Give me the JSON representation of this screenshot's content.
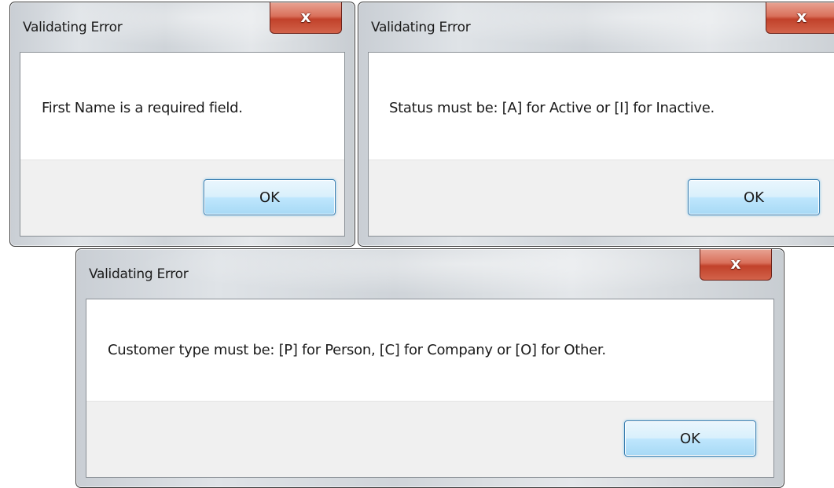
{
  "dialogs": [
    {
      "title": "Validating Error",
      "message": "First Name is a required field.",
      "ok_label": "OK",
      "close_glyph": "x"
    },
    {
      "title": "Validating Error",
      "message": "Status must be: [A] for Active or [I] for Inactive.",
      "ok_label": "OK",
      "close_glyph": "x"
    },
    {
      "title": "Validating Error",
      "message": "Customer type must be: [P] for Person, [C] for Company or [O] for Other.",
      "ok_label": "OK",
      "close_glyph": "x"
    }
  ],
  "colors": {
    "close_button": "#c7432c",
    "ok_button_border": "#3c7fb1",
    "footer": "#f0f0f0",
    "frame": "#cfd4d9"
  }
}
